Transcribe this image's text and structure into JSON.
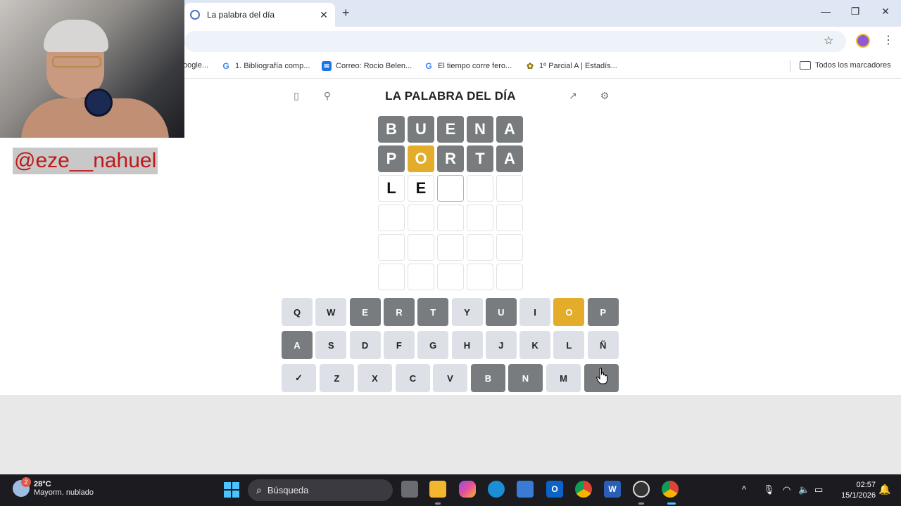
{
  "browser": {
    "tab_title": "La palabra del día",
    "tab_close": "✕",
    "new_tab": "+",
    "window_controls": {
      "minimize": "—",
      "restore": "❐",
      "close": "✕"
    },
    "star": "☆",
    "menu": "⋮",
    "bookmarks": [
      {
        "label": "oogle...",
        "icon": "none"
      },
      {
        "label": "1. Bibliografía comp...",
        "icon": "google-icon"
      },
      {
        "label": "Correo: Rocio Belen...",
        "icon": "outlook-icon"
      },
      {
        "label": "El tiempo corre fero...",
        "icon": "google-icon"
      },
      {
        "label": "1º Parcial A | Estadís...",
        "icon": "moodle-icon"
      }
    ],
    "all_bookmarks": "Todos los marcadores"
  },
  "overlay": {
    "handle": "@eze__nahuel"
  },
  "game": {
    "title": "LA PALABRA DEL DÍA",
    "icons": {
      "left1": "▯",
      "left2": "⚲",
      "right1": "↗",
      "right2": "⚙"
    },
    "rows": [
      [
        {
          "letter": "B",
          "state": "gray"
        },
        {
          "letter": "U",
          "state": "gray"
        },
        {
          "letter": "E",
          "state": "gray"
        },
        {
          "letter": "N",
          "state": "gray"
        },
        {
          "letter": "A",
          "state": "gray"
        }
      ],
      [
        {
          "letter": "P",
          "state": "gray"
        },
        {
          "letter": "O",
          "state": "yellow"
        },
        {
          "letter": "R",
          "state": "gray"
        },
        {
          "letter": "T",
          "state": "gray"
        },
        {
          "letter": "A",
          "state": "gray"
        }
      ],
      [
        {
          "letter": "L",
          "state": "typed"
        },
        {
          "letter": "E",
          "state": "typed"
        },
        {
          "letter": "",
          "state": "active"
        },
        {
          "letter": "",
          "state": "empty"
        },
        {
          "letter": "",
          "state": "empty"
        }
      ],
      [
        {
          "letter": "",
          "state": "empty"
        },
        {
          "letter": "",
          "state": "empty"
        },
        {
          "letter": "",
          "state": "empty"
        },
        {
          "letter": "",
          "state": "empty"
        },
        {
          "letter": "",
          "state": "empty"
        }
      ],
      [
        {
          "letter": "",
          "state": "empty"
        },
        {
          "letter": "",
          "state": "empty"
        },
        {
          "letter": "",
          "state": "empty"
        },
        {
          "letter": "",
          "state": "empty"
        },
        {
          "letter": "",
          "state": "empty"
        }
      ],
      [
        {
          "letter": "",
          "state": "empty"
        },
        {
          "letter": "",
          "state": "empty"
        },
        {
          "letter": "",
          "state": "empty"
        },
        {
          "letter": "",
          "state": "empty"
        },
        {
          "letter": "",
          "state": "empty"
        }
      ]
    ],
    "keyboard": [
      [
        {
          "k": "Q",
          "s": "normal"
        },
        {
          "k": "W",
          "s": "normal"
        },
        {
          "k": "E",
          "s": "gray"
        },
        {
          "k": "R",
          "s": "gray"
        },
        {
          "k": "T",
          "s": "gray"
        },
        {
          "k": "Y",
          "s": "normal"
        },
        {
          "k": "U",
          "s": "gray"
        },
        {
          "k": "I",
          "s": "normal"
        },
        {
          "k": "O",
          "s": "yellow"
        },
        {
          "k": "P",
          "s": "gray"
        }
      ],
      [
        {
          "k": "A",
          "s": "gray"
        },
        {
          "k": "S",
          "s": "normal"
        },
        {
          "k": "D",
          "s": "normal"
        },
        {
          "k": "F",
          "s": "normal"
        },
        {
          "k": "G",
          "s": "normal"
        },
        {
          "k": "H",
          "s": "normal"
        },
        {
          "k": "J",
          "s": "normal"
        },
        {
          "k": "K",
          "s": "normal"
        },
        {
          "k": "L",
          "s": "normal"
        },
        {
          "k": "Ñ",
          "s": "normal"
        }
      ],
      [
        {
          "k": "✓",
          "s": "normal"
        },
        {
          "k": "Z",
          "s": "normal"
        },
        {
          "k": "X",
          "s": "normal"
        },
        {
          "k": "C",
          "s": "normal"
        },
        {
          "k": "V",
          "s": "normal"
        },
        {
          "k": "B",
          "s": "gray"
        },
        {
          "k": "N",
          "s": "gray"
        },
        {
          "k": "M",
          "s": "normal"
        },
        {
          "k": "",
          "s": "del"
        }
      ]
    ],
    "colors": {
      "gray": "#787c7e",
      "yellow": "#e3ac2a",
      "key": "#dde1e7"
    }
  },
  "taskbar": {
    "weather_badge": "2",
    "temperature": "28°C",
    "condition": "Mayorm. nublado",
    "search_placeholder": "Búsqueda",
    "apps": [
      "task-view",
      "file-explorer",
      "copilot",
      "edge",
      "store",
      "outlook",
      "chrome",
      "word",
      "obs",
      "chrome-profile"
    ],
    "time": "02:57",
    "date": "15/1/2026"
  }
}
